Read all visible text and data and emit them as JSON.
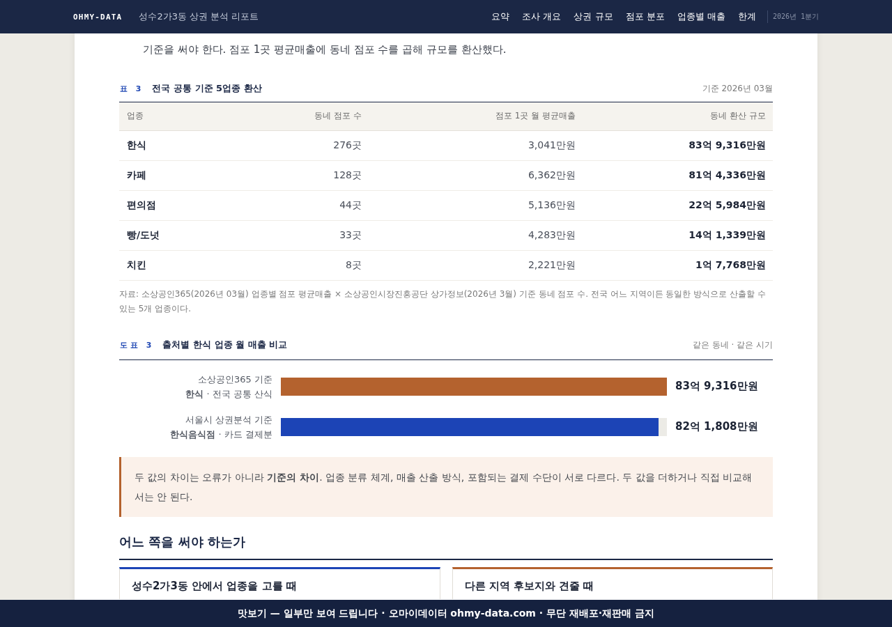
{
  "header": {
    "logo": "OHMY-DATA",
    "report_title": "성수2가3동 상권 분석 리포트",
    "nav": [
      "요약",
      "조사 개요",
      "상권 규모",
      "점포 분포",
      "업종별 매출",
      "한계"
    ],
    "period": "2026년 1분기"
  },
  "intro": {
    "text": "기준을 써야 한다. 점포 1곳 평균매출에 동네 점포 수를 곱해 규모를 환산했다."
  },
  "table": {
    "number_label": "표 3",
    "title": "전국 공통 기준 5업종 환산",
    "as_of": "기준 2026년 03월",
    "columns": [
      "업종",
      "동네 점포 수",
      "점포 1곳 월 평균매출",
      "동네 환산 규모"
    ],
    "rows": [
      [
        "한식",
        "276곳",
        "3,041만원",
        "83억 9,316만원"
      ],
      [
        "카페",
        "128곳",
        "6,362만원",
        "81억 4,336만원"
      ],
      [
        "편의점",
        "44곳",
        "5,136만원",
        "22억 5,984만원"
      ],
      [
        "빵/도넛",
        "33곳",
        "4,283만원",
        "14억 1,339만원"
      ],
      [
        "치킨",
        "8곳",
        "2,221만원",
        "1억 7,768만원"
      ]
    ],
    "note": "자료: 소상공인365(2026년 03월) 업종별 점포 평균매출 × 소상공인시장진흥공단 상가정보(2026년 3월) 기준 동네 점포 수. 전국 어느 지역이든 동일한 방식으로 산출할 수 있는 5개 업종이다."
  },
  "figure": {
    "number_label": "도표 3",
    "title": "출처별 한식 업종 월 매출 비교",
    "context": "같은 동네 · 같은 시기",
    "bars": [
      {
        "label": "소상공인365 기준",
        "note": "**한식** · 전국 공통 산식",
        "color": "#b4622e",
        "level": 1,
        "reading": "83억 9,316만원"
      },
      {
        "label": "서울시 상권분석 기준",
        "note": "**한식음식점** · 카드 결제분",
        "color": "#1c44b6",
        "level": 0.979,
        "reading": "82억 1,808만원"
      }
    ]
  },
  "callout": {
    "text": "두 값의 차이는 오류가 아니라 **기준의 차이**. 업종 분류 체계, 매출 산출 방식, 포함되는 결제 수단이 서로 다르다. 두 값을 더하거나 직접 비교해서는 안 된다."
  },
  "section": {
    "heading": "어느 쪽을 써야 하는가",
    "cards": [
      {
        "title": "성수2가3동 안에서 업종을 고를 때",
        "color": "#1c44b6"
      },
      {
        "title": "다른 지역 후보지와 견줄 때",
        "color": "#b4622e"
      }
    ]
  },
  "footer": {
    "text": "맛보기 — 일부만 보여 드립니다 · 오마이데이터 ohmy-data.com · 무단 재배포·재판매 금지"
  }
}
